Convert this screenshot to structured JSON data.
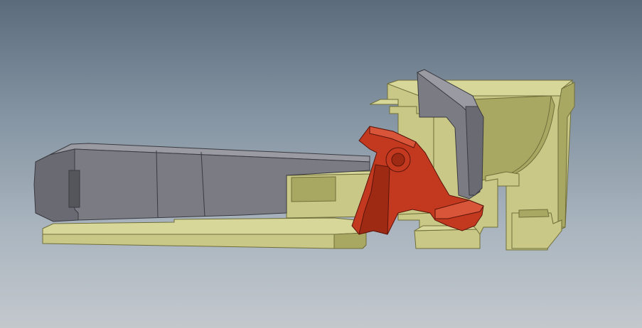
{
  "viewport": {
    "background_top": "#5b6b7c",
    "background_bottom": "#c3c8cd"
  },
  "parts": {
    "housing_color": "#c9c886",
    "housing_shade": "#a9a862",
    "housing_edge": "#6f6e3a",
    "barrel_color": "#7b7b83",
    "barrel_edge": "#3a3a40",
    "trigger_color": "#c2391f",
    "trigger_edge": "#5a140a"
  }
}
